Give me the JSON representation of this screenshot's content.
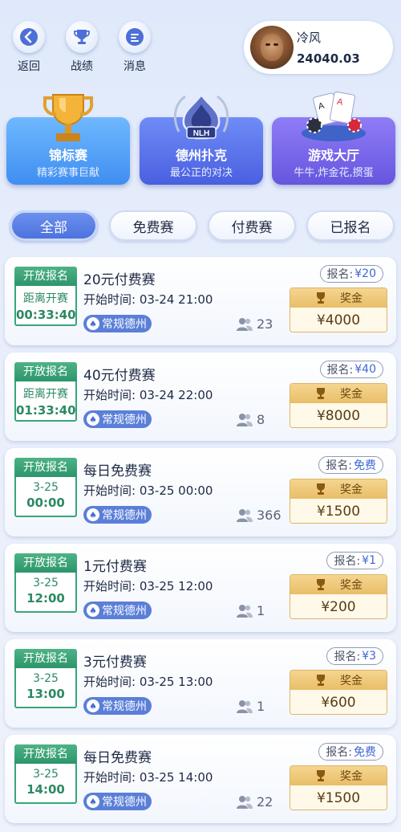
{
  "nav": {
    "back_label": "返回",
    "record_label": "战绩",
    "message_label": "消息"
  },
  "profile": {
    "name": "冷风",
    "coins": "24040.03"
  },
  "categories": [
    {
      "title": "锦标赛",
      "sub": "精彩赛事巨献"
    },
    {
      "title": "德州扑克",
      "sub": "最公正的对决",
      "badge": "NLH"
    },
    {
      "title": "游戏大厅",
      "sub": "牛牛,炸金花,掼蛋"
    }
  ],
  "tabs": [
    "全部",
    "免费赛",
    "付费赛",
    "已报名"
  ],
  "prize_label": "奖金",
  "fee_label": "报名:",
  "tournaments": [
    {
      "status": "开放报名",
      "t1": "距离开赛",
      "t2": "00:33:40",
      "title": "20元付费赛",
      "start": "开始时间: 03-24 21:00",
      "type": "常规德州",
      "players": "23",
      "fee": "¥20",
      "prize": "¥4000"
    },
    {
      "status": "开放报名",
      "t1": "距离开赛",
      "t2": "01:33:40",
      "title": "40元付费赛",
      "start": "开始时间: 03-24 22:00",
      "type": "常规德州",
      "players": "8",
      "fee": "¥40",
      "prize": "¥8000"
    },
    {
      "status": "开放报名",
      "t1": "3-25",
      "t2": "00:00",
      "title": "每日免费赛",
      "start": "开始时间: 03-25 00:00",
      "type": "常规德州",
      "players": "366",
      "fee": "免费",
      "prize": "¥1500"
    },
    {
      "status": "开放报名",
      "t1": "3-25",
      "t2": "12:00",
      "title": "1元付费赛",
      "start": "开始时间: 03-25 12:00",
      "type": "常规德州",
      "players": "1",
      "fee": "¥1",
      "prize": "¥200"
    },
    {
      "status": "开放报名",
      "t1": "3-25",
      "t2": "13:00",
      "title": "3元付费赛",
      "start": "开始时间: 03-25 13:00",
      "type": "常规德州",
      "players": "1",
      "fee": "¥3",
      "prize": "¥600"
    },
    {
      "status": "开放报名",
      "t1": "3-25",
      "t2": "14:00",
      "title": "每日免费赛",
      "start": "开始时间: 03-25 14:00",
      "type": "常规德州",
      "players": "22",
      "fee": "免费",
      "prize": "¥1500"
    }
  ]
}
